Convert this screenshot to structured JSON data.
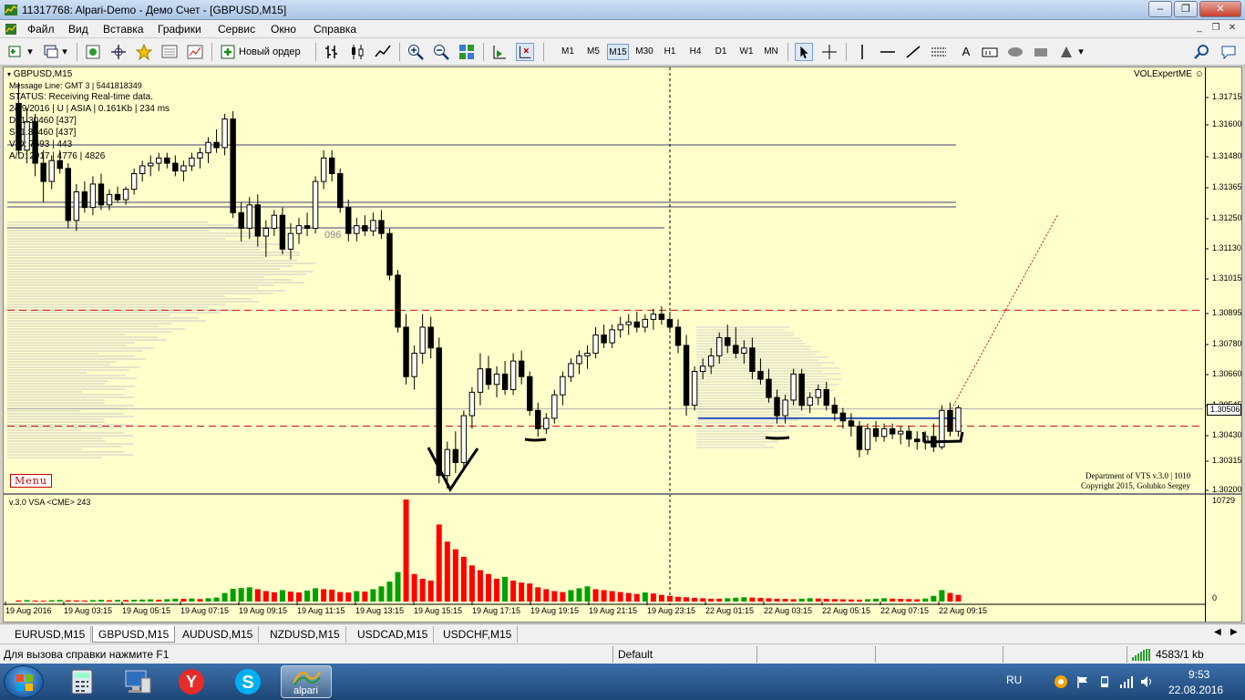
{
  "window": {
    "title": "11317768: Alpari-Demo - Демо Счет - [GBPUSD,M15]",
    "minimize": "‒",
    "maximize": "❐",
    "close": "✕"
  },
  "menu": [
    "Файл",
    "Вид",
    "Вставка",
    "Графики",
    "Сервис",
    "Окно",
    "Справка"
  ],
  "toolbar": {
    "new_order": "Новый ордер",
    "timeframes": [
      "M1",
      "M5",
      "M15",
      "M30",
      "H1",
      "H4",
      "D1",
      "W1",
      "MN"
    ],
    "active_timeframe": "M15",
    "text_tool": "A"
  },
  "chart_info": {
    "symbol": "GBPUSD,M15",
    "message_line": "Message Line: GMT 3 | 5441818349",
    "status": "STATUS:  Receiving Real-time data.",
    "session": "24/9/2016 | U | ASIA | 0.161Kb | 234 ms",
    "d_line": "D: 1.30460 [437]",
    "s_line": "S: 1.30460 [437]",
    "vd_line": "V|D: 7693 | 443",
    "ad_line": "A/D: 2917 | 4776 | 4826",
    "expert": "VOLExpertME",
    "menu_badge": "Menu",
    "level_label": "096",
    "credit_1": "Department of VTS  v.3.0 | 1010",
    "credit_2": "Copyright 2015, Golubko Sergey",
    "volume_header": "v.3.0 VSA <CME> 243"
  },
  "chart_data": {
    "type": "candlestick",
    "symbol": "GBPUSD",
    "timeframe": "M15",
    "price_axis_ticks": [
      "1.31715",
      "1.31600",
      "1.31480",
      "1.31365",
      "1.31250",
      "1.31130",
      "1.31015",
      "1.30895",
      "1.30780",
      "1.30660",
      "1.30545",
      "1.30430",
      "1.30315",
      "1.30200"
    ],
    "current_price": "1.30506",
    "ylim": [
      1.302,
      1.3179
    ],
    "volume_axis_ticks": [
      "10729",
      "0"
    ],
    "volume_ylim": [
      0,
      10729
    ],
    "time_axis_ticks": [
      "19 Aug 2016",
      "19 Aug 03:15",
      "19 Aug 05:15",
      "19 Aug 07:15",
      "19 Aug 09:15",
      "19 Aug 11:15",
      "19 Aug 13:15",
      "19 Aug 15:15",
      "19 Aug 17:15",
      "19 Aug 19:15",
      "19 Aug 21:15",
      "19 Aug 23:15",
      "22 Aug 01:15",
      "22 Aug 03:15",
      "22 Aug 05:15",
      "22 Aug 07:15",
      "22 Aug 09:15"
    ],
    "ohlc": [
      [
        1.3168,
        1.3176,
        1.3148,
        1.315
      ],
      [
        1.315,
        1.3166,
        1.3145,
        1.3161
      ],
      [
        1.3161,
        1.3164,
        1.314,
        1.3145
      ],
      [
        1.3145,
        1.315,
        1.313,
        1.3138
      ],
      [
        1.3138,
        1.3148,
        1.3135,
        1.3146
      ],
      [
        1.3146,
        1.315,
        1.3141,
        1.3143
      ],
      [
        1.3143,
        1.3145,
        1.312,
        1.3123
      ],
      [
        1.3123,
        1.3137,
        1.3119,
        1.3134
      ],
      [
        1.3134,
        1.3138,
        1.3126,
        1.3128
      ],
      [
        1.3128,
        1.314,
        1.3125,
        1.3137
      ],
      [
        1.3137,
        1.3141,
        1.3127,
        1.3129
      ],
      [
        1.3129,
        1.3135,
        1.3127,
        1.3133
      ],
      [
        1.3133,
        1.3136,
        1.313,
        1.3131
      ],
      [
        1.3131,
        1.3136,
        1.3129,
        1.3135
      ],
      [
        1.3135,
        1.3143,
        1.3133,
        1.3141
      ],
      [
        1.3141,
        1.3146,
        1.3138,
        1.3144
      ],
      [
        1.3144,
        1.3148,
        1.314,
        1.3145
      ],
      [
        1.3145,
        1.3149,
        1.3142,
        1.3147
      ],
      [
        1.3147,
        1.3149,
        1.3143,
        1.3145
      ],
      [
        1.3145,
        1.3148,
        1.314,
        1.3142
      ],
      [
        1.3142,
        1.3146,
        1.3138,
        1.3144
      ],
      [
        1.3144,
        1.3149,
        1.3142,
        1.3147
      ],
      [
        1.3147,
        1.3151,
        1.3143,
        1.3149
      ],
      [
        1.3149,
        1.3155,
        1.3145,
        1.3153
      ],
      [
        1.3153,
        1.3158,
        1.3149,
        1.3151
      ],
      [
        1.3151,
        1.3164,
        1.3148,
        1.3162
      ],
      [
        1.3162,
        1.3165,
        1.3124,
        1.3126
      ],
      [
        1.3126,
        1.313,
        1.3115,
        1.312
      ],
      [
        1.312,
        1.3132,
        1.3116,
        1.3129
      ],
      [
        1.3129,
        1.3133,
        1.3113,
        1.3117
      ],
      [
        1.3117,
        1.3123,
        1.3109,
        1.312
      ],
      [
        1.312,
        1.3127,
        1.3117,
        1.3125
      ],
      [
        1.3125,
        1.3128,
        1.311,
        1.3112
      ],
      [
        1.3112,
        1.3122,
        1.3108,
        1.3118
      ],
      [
        1.3118,
        1.3124,
        1.3114,
        1.3121
      ],
      [
        1.3121,
        1.3126,
        1.3117,
        1.312
      ],
      [
        1.312,
        1.314,
        1.3118,
        1.3138
      ],
      [
        1.3138,
        1.315,
        1.3135,
        1.3147
      ],
      [
        1.3147,
        1.315,
        1.3138,
        1.3141
      ],
      [
        1.3141,
        1.3143,
        1.3126,
        1.3128
      ],
      [
        1.3128,
        1.3131,
        1.3115,
        1.3118
      ],
      [
        1.3118,
        1.3124,
        1.3115,
        1.3121
      ],
      [
        1.3121,
        1.3125,
        1.3117,
        1.3119
      ],
      [
        1.3119,
        1.3126,
        1.3117,
        1.3123
      ],
      [
        1.3123,
        1.3127,
        1.3116,
        1.3118
      ],
      [
        1.3118,
        1.312,
        1.31,
        1.3102
      ],
      [
        1.3102,
        1.3104,
        1.308,
        1.3082
      ],
      [
        1.3082,
        1.3087,
        1.306,
        1.3063
      ],
      [
        1.3063,
        1.3075,
        1.3058,
        1.3072
      ],
      [
        1.3072,
        1.3087,
        1.3068,
        1.3082
      ],
      [
        1.3082,
        1.3086,
        1.307,
        1.3074
      ],
      [
        1.3074,
        1.3078,
        1.3022,
        1.3025
      ],
      [
        1.3025,
        1.3038,
        1.302,
        1.3035
      ],
      [
        1.3035,
        1.3042,
        1.3026,
        1.303
      ],
      [
        1.303,
        1.305,
        1.3028,
        1.3048
      ],
      [
        1.3048,
        1.3059,
        1.3043,
        1.3057
      ],
      [
        1.3057,
        1.3072,
        1.3052,
        1.3066
      ],
      [
        1.3066,
        1.3071,
        1.3058,
        1.306
      ],
      [
        1.306,
        1.3067,
        1.3055,
        1.3064
      ],
      [
        1.3064,
        1.3069,
        1.3056,
        1.3058
      ],
      [
        1.3058,
        1.3072,
        1.3056,
        1.3069
      ],
      [
        1.3069,
        1.3073,
        1.306,
        1.3063
      ],
      [
        1.3063,
        1.3065,
        1.3048,
        1.305
      ],
      [
        1.305,
        1.3053,
        1.304,
        1.3043
      ],
      [
        1.3043,
        1.3049,
        1.3041,
        1.3047
      ],
      [
        1.3047,
        1.3058,
        1.3045,
        1.3056
      ],
      [
        1.3056,
        1.3065,
        1.3052,
        1.3063
      ],
      [
        1.3063,
        1.307,
        1.3061,
        1.3068
      ],
      [
        1.3068,
        1.3073,
        1.3064,
        1.3071
      ],
      [
        1.3071,
        1.3075,
        1.3066,
        1.3072
      ],
      [
        1.3072,
        1.3082,
        1.307,
        1.3079
      ],
      [
        1.3079,
        1.3083,
        1.3074,
        1.3076
      ],
      [
        1.3076,
        1.3083,
        1.3074,
        1.3081
      ],
      [
        1.3081,
        1.3086,
        1.3078,
        1.3083
      ],
      [
        1.3083,
        1.3087,
        1.3079,
        1.3084
      ],
      [
        1.3084,
        1.3088,
        1.308,
        1.3082
      ],
      [
        1.3082,
        1.3087,
        1.308,
        1.3085
      ],
      [
        1.3085,
        1.3089,
        1.3081,
        1.3087
      ],
      [
        1.3087,
        1.309,
        1.3083,
        1.3085
      ],
      [
        1.3085,
        1.3088,
        1.308,
        1.3082
      ],
      [
        1.3082,
        1.3085,
        1.3072,
        1.3075
      ],
      [
        1.3075,
        1.3079,
        1.3048,
        1.3052
      ],
      [
        1.3052,
        1.3067,
        1.305,
        1.3065
      ],
      [
        1.3065,
        1.307,
        1.3062,
        1.3067
      ],
      [
        1.3067,
        1.3074,
        1.3064,
        1.3071
      ],
      [
        1.3071,
        1.308,
        1.3068,
        1.3078
      ],
      [
        1.3078,
        1.3083,
        1.3072,
        1.3075
      ],
      [
        1.3075,
        1.3082,
        1.307,
        1.3072
      ],
      [
        1.3072,
        1.3077,
        1.3068,
        1.3074
      ],
      [
        1.3074,
        1.3078,
        1.3062,
        1.3065
      ],
      [
        1.3065,
        1.307,
        1.306,
        1.3062
      ],
      [
        1.3062,
        1.3066,
        1.3053,
        1.3055
      ],
      [
        1.3055,
        1.3058,
        1.3045,
        1.3048
      ],
      [
        1.3048,
        1.3056,
        1.3045,
        1.3054
      ],
      [
        1.3054,
        1.3066,
        1.3052,
        1.3064
      ],
      [
        1.3064,
        1.3066,
        1.305,
        1.3052
      ],
      [
        1.3052,
        1.3057,
        1.3049,
        1.3055
      ],
      [
        1.3055,
        1.306,
        1.3052,
        1.3058
      ],
      [
        1.3058,
        1.3061,
        1.305,
        1.3052
      ],
      [
        1.3052,
        1.3055,
        1.3046,
        1.3049
      ],
      [
        1.3049,
        1.3051,
        1.3043,
        1.3046
      ],
      [
        1.3046,
        1.3049,
        1.304,
        1.3044
      ],
      [
        1.3044,
        1.3046,
        1.3032,
        1.3035
      ],
      [
        1.3035,
        1.3045,
        1.3033,
        1.3043
      ],
      [
        1.3043,
        1.3046,
        1.3038,
        1.304
      ],
      [
        1.304,
        1.3045,
        1.3038,
        1.3043
      ],
      [
        1.3043,
        1.3045,
        1.3039,
        1.3041
      ],
      [
        1.3041,
        1.3044,
        1.3037,
        1.3042
      ],
      [
        1.3042,
        1.3044,
        1.3036,
        1.3039
      ],
      [
        1.3039,
        1.3042,
        1.3035,
        1.3038
      ],
      [
        1.3038,
        1.3042,
        1.3035,
        1.304
      ],
      [
        1.304,
        1.3045,
        1.3034,
        1.3036
      ],
      [
        1.3036,
        1.3052,
        1.3035,
        1.305
      ],
      [
        1.305,
        1.3053,
        1.304,
        1.3042
      ],
      [
        1.3042,
        1.3052,
        1.304,
        1.3051
      ]
    ],
    "volume": [
      120,
      150,
      110,
      90,
      140,
      160,
      130,
      120,
      110,
      150,
      180,
      140,
      170,
      160,
      190,
      210,
      230,
      200,
      250,
      300,
      280,
      320,
      260,
      350,
      420,
      900,
      1350,
      1420,
      1500,
      1300,
      1100,
      980,
      1200,
      1050,
      950,
      1150,
      1400,
      1300,
      1250,
      1000,
      950,
      1100,
      1050,
      1300,
      1600,
      2100,
      3100,
      10729,
      2900,
      2400,
      2200,
      8100,
      6300,
      5500,
      4700,
      3800,
      3300,
      2900,
      2400,
      2600,
      2200,
      2000,
      1900,
      1500,
      1300,
      1100,
      1000,
      1200,
      1400,
      1600,
      1300,
      1200,
      1100,
      1000,
      900,
      800,
      950,
      850,
      700,
      600,
      500,
      450,
      400,
      350,
      300,
      300,
      350,
      400,
      450,
      420,
      380,
      350,
      300,
      280,
      250,
      300,
      350,
      320,
      280,
      260,
      240,
      220,
      200,
      250,
      300,
      350,
      300,
      280,
      260,
      240,
      320,
      600,
      1200,
      900,
      700
    ],
    "reference_lines": [
      {
        "label": "dashed_red",
        "price": 1.30885
      },
      {
        "label": "dashed_red",
        "price": 1.3044
      },
      {
        "label": "level_blue",
        "price": 1.3047
      },
      {
        "label": "level_gray",
        "price": 1.30506
      }
    ]
  },
  "tabs": [
    "EURUSD,M15",
    "GBPUSD,M15",
    "AUDUSD,M15",
    "NZDUSD,M15",
    "USDCAD,M15",
    "USDCHF,M15"
  ],
  "active_tab": "GBPUSD,M15",
  "statusbar": {
    "help": "Для вызова справки нажмите F1",
    "profile": "Default",
    "traffic": "4583/1 kb"
  },
  "taskbar": {
    "language": "RU",
    "time": "9:53",
    "date": "22.08.2016",
    "alpari_label": "alpari"
  }
}
